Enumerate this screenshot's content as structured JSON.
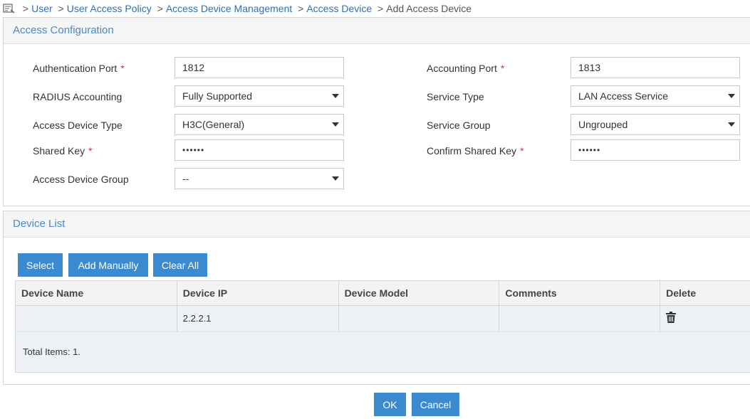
{
  "breadcrumb": {
    "items": [
      "User",
      "User Access Policy",
      "Access Device Management",
      "Access Device"
    ],
    "separator": ">",
    "current": "Add Access Device"
  },
  "access_config": {
    "title": "Access Configuration",
    "auth_port": {
      "label": "Authentication Port",
      "required": "*",
      "value": "1812"
    },
    "acct_port": {
      "label": "Accounting Port",
      "required": "*",
      "value": "1813"
    },
    "radius_accounting": {
      "label": "RADIUS Accounting",
      "value": "Fully Supported"
    },
    "service_type": {
      "label": "Service Type",
      "value": "LAN Access Service"
    },
    "device_type": {
      "label": "Access Device Type",
      "value": "H3C(General)"
    },
    "service_group": {
      "label": "Service Group",
      "value": "Ungrouped"
    },
    "shared_key": {
      "label": "Shared Key",
      "required": "*",
      "value": "••••••"
    },
    "confirm_key": {
      "label": "Confirm Shared Key",
      "required": "*",
      "value": "••••••"
    },
    "device_group": {
      "label": "Access Device Group",
      "value": "--"
    }
  },
  "device_list": {
    "title": "Device List",
    "buttons": {
      "select": "Select",
      "add_manually": "Add Manually",
      "clear_all": "Clear All"
    },
    "columns": [
      "Device Name",
      "Device IP",
      "Device Model",
      "Comments",
      "Delete"
    ],
    "rows": [
      {
        "name": "",
        "ip": "2.2.2.1",
        "model": "",
        "comments": ""
      }
    ],
    "total": "Total Items: 1."
  },
  "footer": {
    "ok": "OK",
    "cancel": "Cancel"
  },
  "colors": {
    "link": "#2f6fb1",
    "accent": "#3b8ad0",
    "required": "#e02a2a",
    "section_title": "#4a8ac8"
  }
}
